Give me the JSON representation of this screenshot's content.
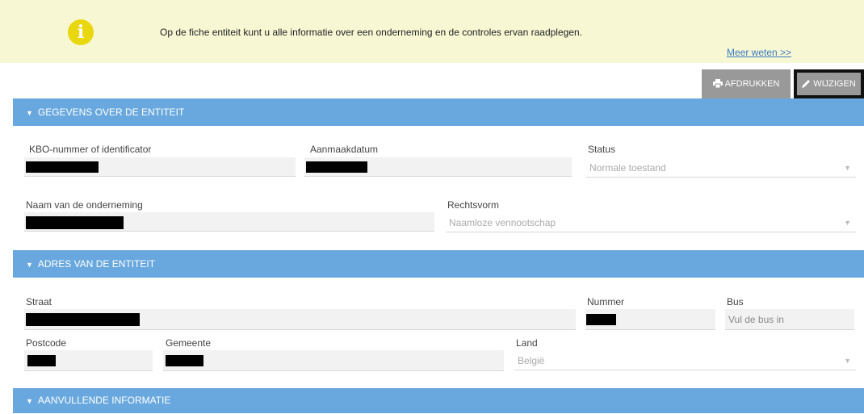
{
  "info_banner": {
    "text": "Op de fiche entiteit kunt u alle informatie over een onderneming en de controles ervan raadplegen.",
    "link": "Meer weten >>"
  },
  "toolbar": {
    "print_label": "AFDRUKKEN",
    "edit_label": "WIJZIGEN"
  },
  "sections": {
    "entity": {
      "title": "GEGEVENS OVER DE ENTITEIT"
    },
    "address": {
      "title": "ADRES VAN DE ENTITEIT"
    },
    "extra": {
      "title": "AANVULLENDE INFORMATIE"
    }
  },
  "entity": {
    "kbo_label": "KBO-nummer of identificator",
    "created_label": "Aanmaakdatum",
    "status_label": "Status",
    "status_value": "Normale toestand",
    "name_label": "Naam van de onderneming",
    "legal_form_label": "Rechtsvorm",
    "legal_form_value": "Naamloze vennootschap"
  },
  "address": {
    "street_label": "Straat",
    "number_label": "Nummer",
    "bus_label": "Bus",
    "bus_placeholder": "Vul de bus in",
    "postcode_label": "Postcode",
    "municipality_label": "Gemeente",
    "country_label": "Land",
    "country_value": "België"
  },
  "colors": {
    "banner_bg": "#f7f7d4",
    "info_icon": "#e9d80f",
    "section_header": "#69a8de",
    "button_bg": "#999999"
  }
}
